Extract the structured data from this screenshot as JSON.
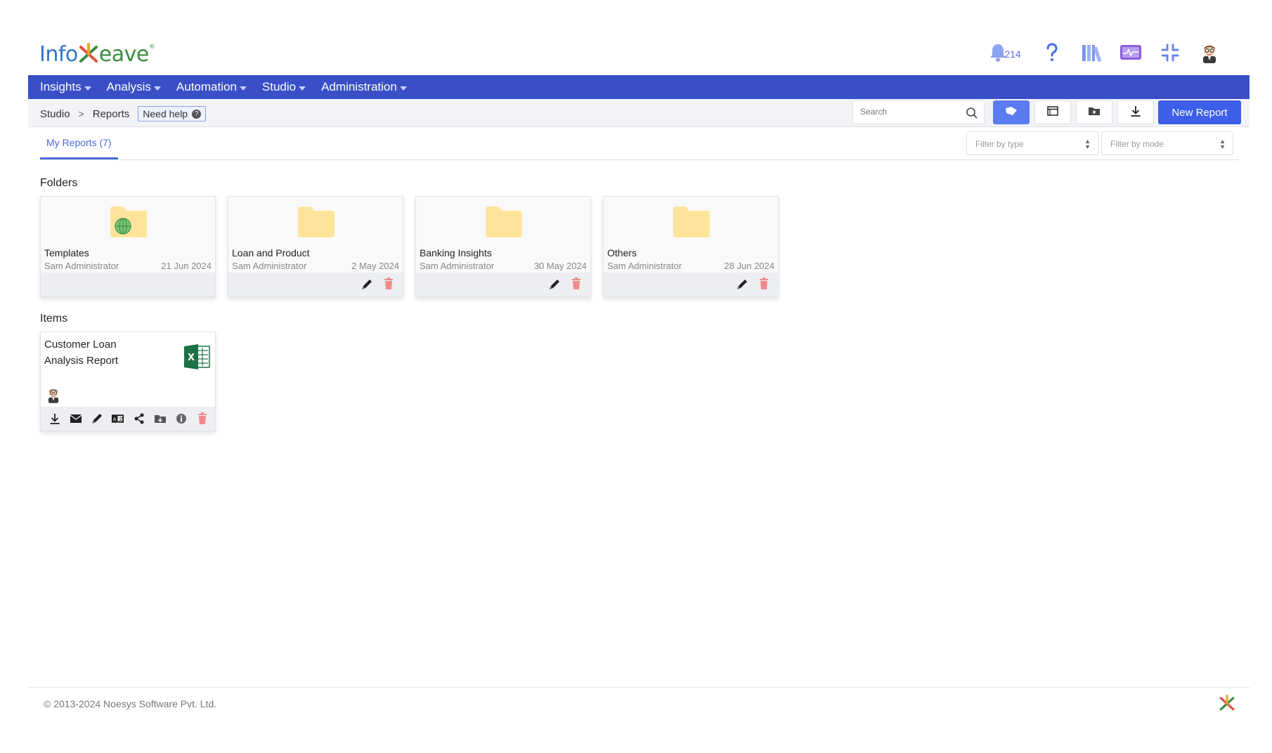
{
  "brand": {
    "name_part1": "Info",
    "name_part2": "eave",
    "trademark": "®"
  },
  "header": {
    "notification_count": "214"
  },
  "nav": [
    {
      "label": "Insights"
    },
    {
      "label": "Analysis"
    },
    {
      "label": "Automation"
    },
    {
      "label": "Studio"
    },
    {
      "label": "Administration"
    }
  ],
  "breadcrumb": {
    "root": "Studio",
    "separator": ">",
    "current": "Reports",
    "help_label": "Need help",
    "help_icon_text": "?"
  },
  "toolbar": {
    "search_placeholder": "Search",
    "new_report_label": "New Report"
  },
  "tabs": {
    "my_reports": "My Reports (7)"
  },
  "filters": {
    "type_placeholder": "Filter by type",
    "mode_placeholder": "Filter by mode"
  },
  "sections": {
    "folders": "Folders",
    "items": "Items"
  },
  "folders": [
    {
      "name": "Templates",
      "owner": "Sam Administrator",
      "date": "21 Jun 2024"
    },
    {
      "name": "Loan and Product",
      "owner": "Sam Administrator",
      "date": "2 May 2024"
    },
    {
      "name": "Banking Insights",
      "owner": "Sam Administrator",
      "date": "30 May 2024"
    },
    {
      "name": "Others",
      "owner": "Sam Administrator",
      "date": "28 Jun 2024"
    }
  ],
  "items": [
    {
      "title": "Customer Loan Analysis Report"
    }
  ],
  "footer": {
    "copyright": "© 2013-2024 Noesys Software Pvt. Ltd."
  },
  "colors": {
    "nav_bg": "#3a4fc7",
    "primary_button": "#3d5ee8",
    "active_toggle": "#5b7bf0",
    "folder": "#fde49a",
    "delete": "#f08a8a"
  }
}
